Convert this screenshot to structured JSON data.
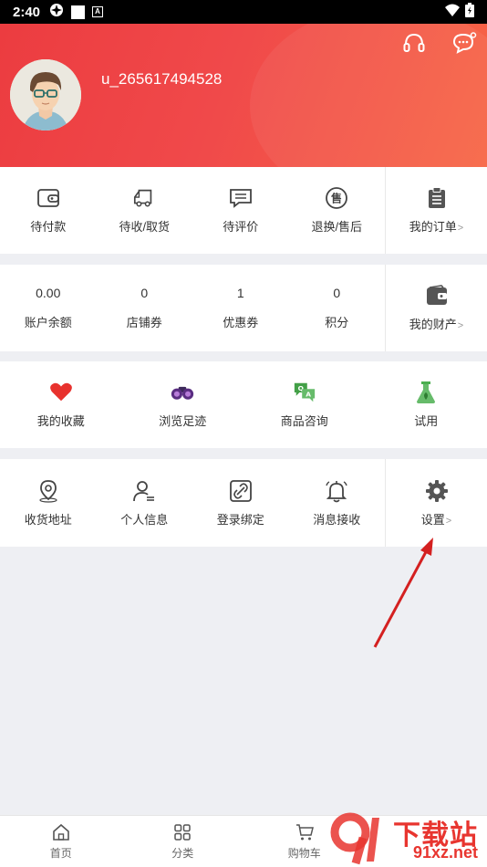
{
  "status_bar": {
    "time": "2:40"
  },
  "profile": {
    "username": "u_265617494528"
  },
  "orders": {
    "items": [
      {
        "label": "待付款",
        "icon": "wallet-icon"
      },
      {
        "label": "待收/取货",
        "icon": "truck-icon"
      },
      {
        "label": "待评价",
        "icon": "comment-icon"
      },
      {
        "label": "退换/售后",
        "icon": "after-sale-icon"
      }
    ],
    "my_orders": {
      "label": "我的订单",
      "icon": "clipboard-icon"
    }
  },
  "assets": {
    "items": [
      {
        "value": "0.00",
        "label": "账户余额"
      },
      {
        "value": "0",
        "label": "店铺券"
      },
      {
        "value": "1",
        "label": "优惠券"
      },
      {
        "value": "0",
        "label": "积分"
      }
    ],
    "my_assets": {
      "label": "我的财产",
      "icon": "purse-icon"
    }
  },
  "favorites": {
    "items": [
      {
        "label": "我的收藏",
        "icon": "heart-icon",
        "color": "#e8322e"
      },
      {
        "label": "浏览足迹",
        "icon": "binoculars-icon",
        "color": "#5a2d82"
      },
      {
        "label": "商品咨询",
        "icon": "qa-chat-icon",
        "color": "#4caf50"
      },
      {
        "label": "试用",
        "icon": "flask-icon",
        "color": "#5cb85c"
      }
    ]
  },
  "settings_row": {
    "items": [
      {
        "label": "收货地址",
        "icon": "location-pin-icon"
      },
      {
        "label": "个人信息",
        "icon": "user-info-icon"
      },
      {
        "label": "登录绑定",
        "icon": "link-icon"
      },
      {
        "label": "消息接收",
        "icon": "bell-icon"
      }
    ],
    "settings": {
      "label": "设置",
      "icon": "gear-icon"
    }
  },
  "tab_bar": {
    "tabs": [
      {
        "label": "首页",
        "icon": "home-icon"
      },
      {
        "label": "分类",
        "icon": "grid-icon"
      },
      {
        "label": "购物车",
        "icon": "cart-icon"
      }
    ]
  },
  "watermark": {
    "text": "下载站",
    "url": "91xz.net"
  },
  "colors": {
    "header_start": "#ec3c40",
    "header_end": "#f76545",
    "accent": "#e8352f"
  }
}
